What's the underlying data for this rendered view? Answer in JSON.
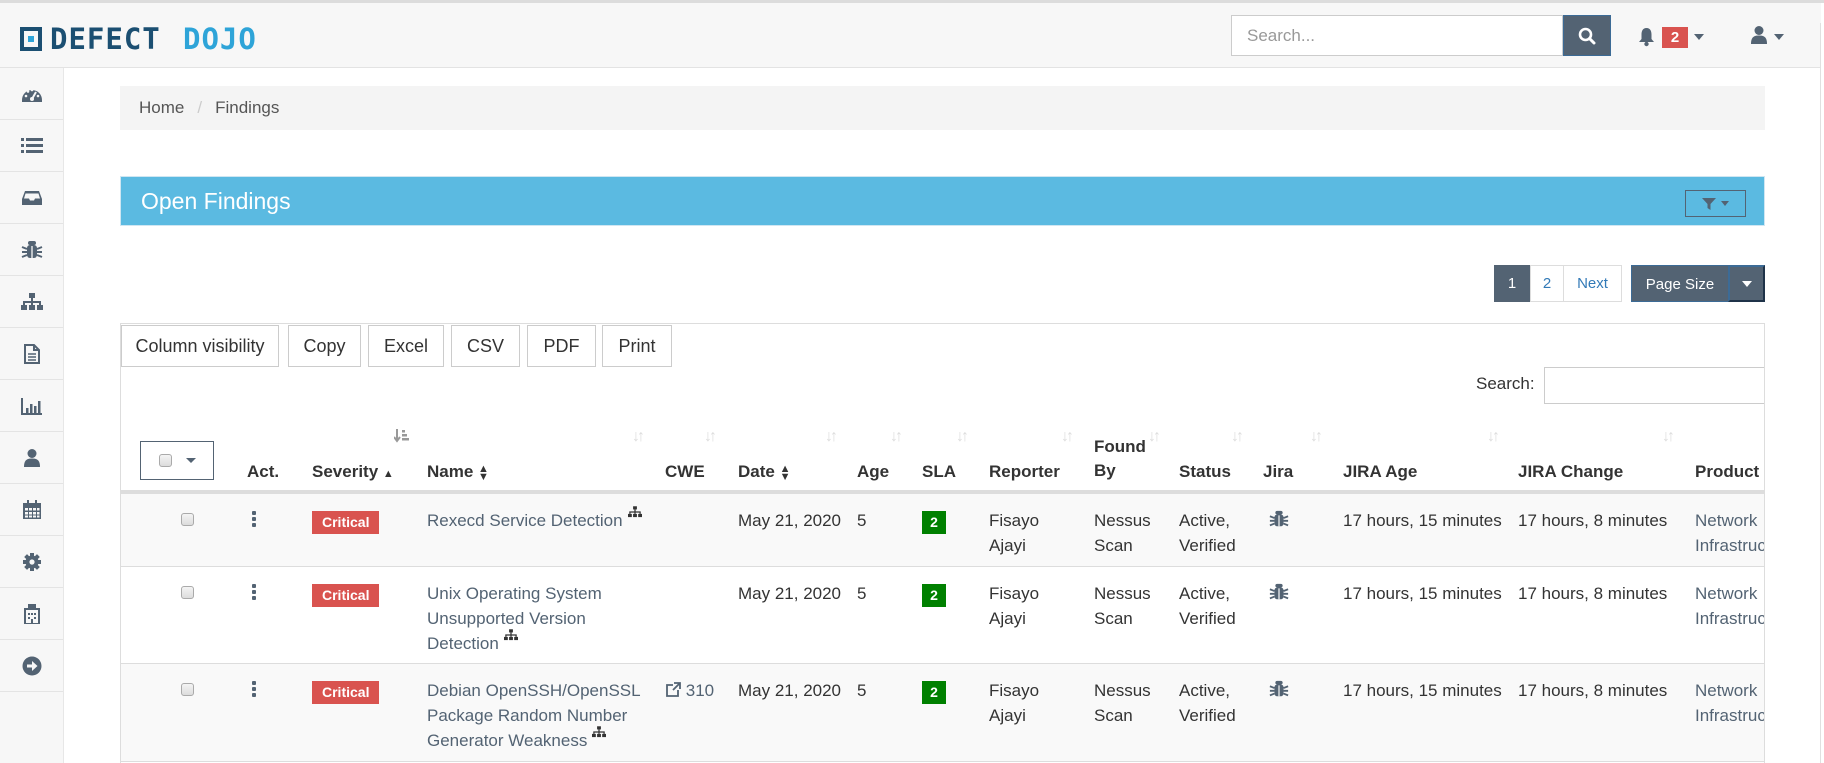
{
  "app": {
    "logo_left": "DEFECT",
    "logo_right": "DOJO",
    "brand_dark": "#1b4f72",
    "brand_light": "#2ea4d8"
  },
  "topnav": {
    "search_placeholder": "Search...",
    "search_value": "",
    "notifications_count": "2",
    "icons": [
      "search-icon",
      "bell-icon",
      "user-icon"
    ]
  },
  "sidebar": {
    "items": [
      {
        "icon": "dashboard-icon"
      },
      {
        "icon": "list-icon"
      },
      {
        "icon": "inbox-icon"
      },
      {
        "icon": "bug-icon"
      },
      {
        "icon": "sitemap-icon"
      },
      {
        "icon": "file-text-icon"
      },
      {
        "icon": "bar-chart-icon"
      },
      {
        "icon": "user-icon"
      },
      {
        "icon": "calendar-icon"
      },
      {
        "icon": "gear-icon"
      },
      {
        "icon": "building-icon"
      },
      {
        "icon": "arrow-circle-right-icon"
      }
    ]
  },
  "breadcrumb": {
    "items": [
      "Home",
      "Findings"
    ],
    "separator": "/"
  },
  "panel": {
    "title": "Open Findings",
    "accent": "#5bbae1"
  },
  "pagination": {
    "pages": [
      "1",
      "2"
    ],
    "current": "1",
    "next_label": "Next",
    "page_size_label": "Page Size"
  },
  "table_tools": {
    "buttons": [
      "Column visibility",
      "Copy",
      "Excel",
      "CSV",
      "PDF",
      "Print"
    ],
    "search_label": "Search:",
    "search_value": ""
  },
  "table": {
    "columns": [
      {
        "key": "select",
        "label": ""
      },
      {
        "key": "act",
        "label": "Act."
      },
      {
        "key": "severity",
        "label": "Severity"
      },
      {
        "key": "name",
        "label": "Name"
      },
      {
        "key": "cwe",
        "label": "CWE"
      },
      {
        "key": "date",
        "label": "Date"
      },
      {
        "key": "age",
        "label": "Age"
      },
      {
        "key": "sla",
        "label": "SLA"
      },
      {
        "key": "reporter",
        "label": "Reporter"
      },
      {
        "key": "found_by",
        "label": "Found By",
        "line1": "Found",
        "line2": "By"
      },
      {
        "key": "status",
        "label": "Status"
      },
      {
        "key": "jira",
        "label": "Jira"
      },
      {
        "key": "jira_age",
        "label": "JIRA Age"
      },
      {
        "key": "jira_change",
        "label": "JIRA Change"
      },
      {
        "key": "product",
        "label": "Product"
      }
    ],
    "sorted_by": "Severity",
    "sort_direction": "ascending",
    "rows": [
      {
        "severity": "Critical",
        "name_lines": [
          "Rexecd Service Detection"
        ],
        "cwe": "",
        "date": "May 21, 2020",
        "age": "5",
        "sla": "2",
        "reporter": [
          "Fisayo",
          "Ajayi"
        ],
        "found_by": [
          "Nessus",
          "Scan"
        ],
        "status": [
          "Active,",
          "Verified"
        ],
        "jira_icon": "bug-icon",
        "jira_age": "17 hours, 15 minutes",
        "jira_change": "17 hours, 8 minutes",
        "product": [
          "Network",
          "Infrastruc"
        ]
      },
      {
        "severity": "Critical",
        "name_lines": [
          "Unix Operating System",
          "Unsupported Version",
          "Detection"
        ],
        "cwe": "",
        "date": "May 21, 2020",
        "age": "5",
        "sla": "2",
        "reporter": [
          "Fisayo",
          "Ajayi"
        ],
        "found_by": [
          "Nessus",
          "Scan"
        ],
        "status": [
          "Active,",
          "Verified"
        ],
        "jira_icon": "bug-icon",
        "jira_age": "17 hours, 15 minutes",
        "jira_change": "17 hours, 8 minutes",
        "product": [
          "Network",
          "Infrastruc"
        ]
      },
      {
        "severity": "Critical",
        "name_lines": [
          "Debian OpenSSH/OpenSSL",
          "Package Random Number",
          "Generator Weakness"
        ],
        "cwe": "310",
        "date": "May 21, 2020",
        "age": "5",
        "sla": "2",
        "reporter": [
          "Fisayo",
          "Ajayi"
        ],
        "found_by": [
          "Nessus",
          "Scan"
        ],
        "status": [
          "Active,",
          "Verified"
        ],
        "jira_icon": "bug-icon",
        "jira_age": "17 hours, 15 minutes",
        "jira_change": "17 hours, 8 minutes",
        "product": [
          "Network",
          "Infrastruc"
        ]
      }
    ]
  },
  "colors": {
    "critical": "#d9534f",
    "sla_ok": "#008000",
    "primary_btn": "#536373"
  }
}
